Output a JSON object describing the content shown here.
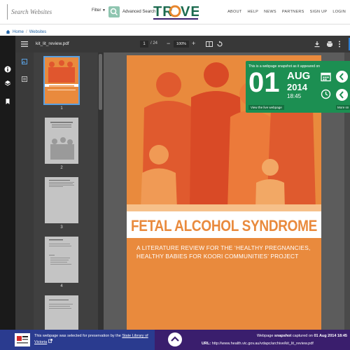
{
  "header": {
    "search_placeholder": "Search Websites",
    "filter_label": "Filter",
    "advanced_search": "Advanced Search",
    "logo_text": "TROVE",
    "nav": [
      "ABOUT",
      "HELP",
      "NEWS",
      "PARTNERS",
      "SIGN UP",
      "LOGIN"
    ]
  },
  "breadcrumb": {
    "home": "Home",
    "separator": "/",
    "current": "Websites"
  },
  "viewer": {
    "filename": "kit_lit_review.pdf",
    "page_current": "1",
    "page_total": "/ 24",
    "zoom": "100%",
    "zoom_out": "−",
    "zoom_in": "+"
  },
  "thumbnails": [
    "1",
    "2",
    "3",
    "4"
  ],
  "document": {
    "title": "FETAL ALCOHOL SYNDROME",
    "subtitle_line1": "A LITERATURE REVIEW FOR THE ‘HEALTHY PREGNANCIES,",
    "subtitle_line2": "HEALTHY BABIES FOR KOORI COMMUNITIES’ PROJECT"
  },
  "snapshot": {
    "intro": "This is a webpage snapshot as it appeared on",
    "day": "01",
    "month": "AUG",
    "year": "2014",
    "time": "18:45",
    "live_btn": "View the live webpage",
    "more_btn": "More sn"
  },
  "footer": {
    "selected_text": "This webpage was selected for preservation by the",
    "library_link": "State Library of",
    "library_link2": "Victoria",
    "capture_prefix": "Webpage",
    "capture_bold": "snapshot",
    "capture_mid": "captured on",
    "capture_date": "01 Aug 2014 18:45",
    "url_label": "URL:",
    "url": "http://www.health.vic.gov.au/vdapc/archive/kit_lit_review.pdf"
  },
  "colors": {
    "accent_green": "#1c8f52",
    "orange_cover": "#e98a3d",
    "footer_blue": "#2a3b8f",
    "footer_purple": "#3a1e6d",
    "link_blue": "#2466a7"
  }
}
